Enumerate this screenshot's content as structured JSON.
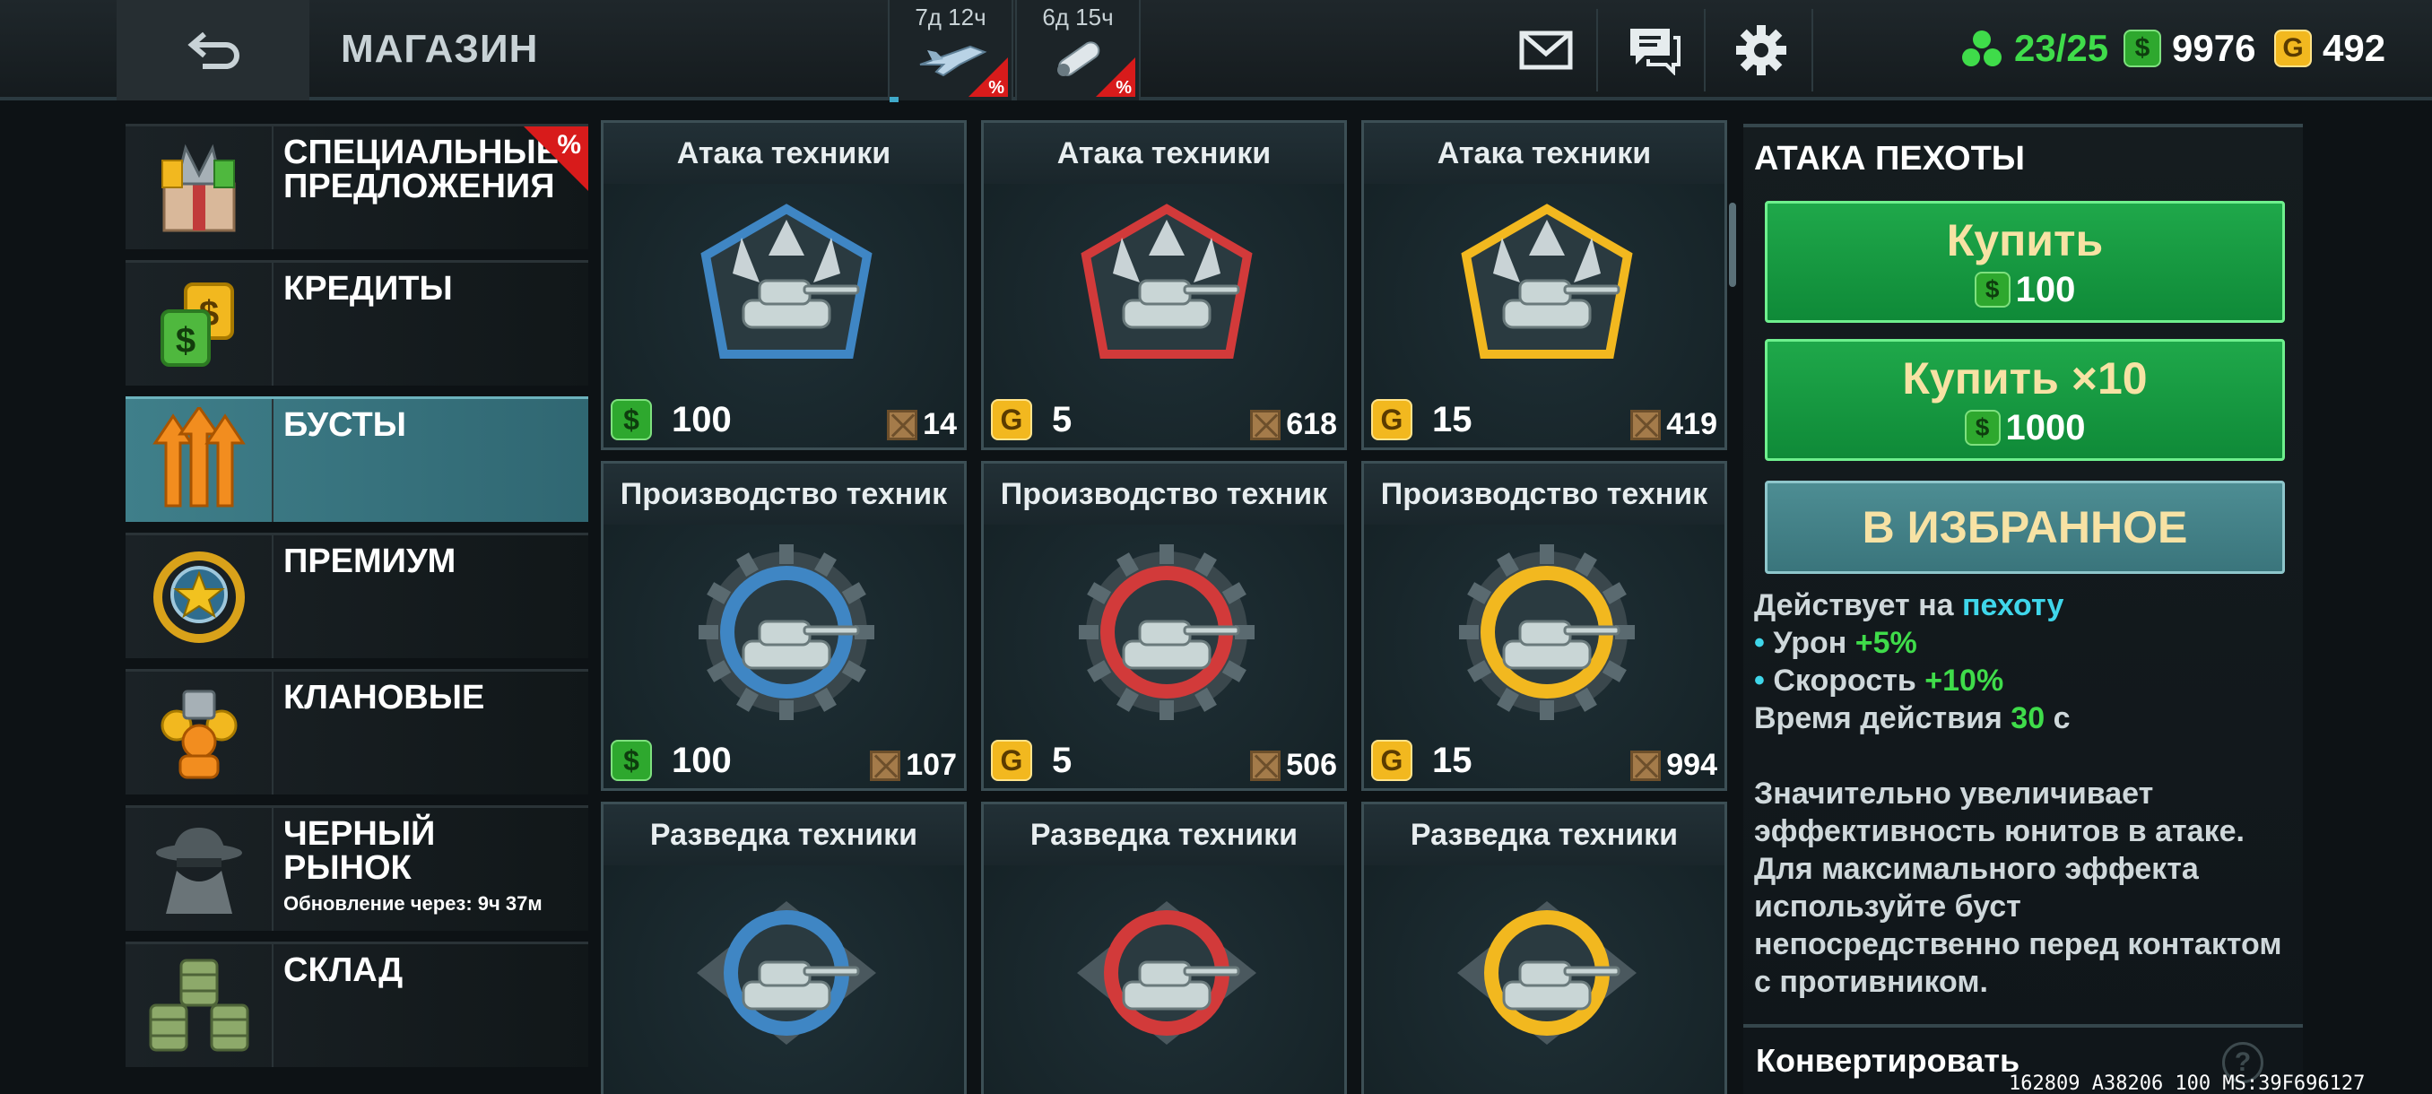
{
  "header": {
    "title": "МАГАЗИН",
    "offers": [
      {
        "timer": "7д 12ч",
        "badge": "%",
        "icon": "jet-icon"
      },
      {
        "timer": "6д 15ч",
        "badge": "%",
        "icon": "missile-icon"
      }
    ],
    "resources": {
      "energy": "23/25",
      "cash": "9976",
      "gold": "492"
    },
    "currency_glyphs": {
      "cash": "$",
      "gold": "G"
    }
  },
  "menu": [
    {
      "label": "СПЕЦИАЛЬНЫЕ ПРЕДЛОЖЕНИЯ",
      "badge": "%",
      "icon": "gift-box-icon"
    },
    {
      "label": "КРЕДИТЫ",
      "icon": "credits-icon"
    },
    {
      "label": "БУСТЫ",
      "icon": "boost-arrows-icon",
      "active": true
    },
    {
      "label": "ПРЕМИУМ",
      "icon": "premium-star-icon"
    },
    {
      "label": "КЛАНОВЫЕ",
      "icon": "clan-icon"
    },
    {
      "label": "ЧЕРНЫЙ РЫНОК",
      "sub": "Обновление через: 9ч 37м",
      "icon": "spy-icon"
    },
    {
      "label": "СКЛАД",
      "icon": "barrels-icon"
    }
  ],
  "items": [
    {
      "title": "Атака техники",
      "tier": "blue",
      "kind": "attack",
      "currency": "cash",
      "price": "100",
      "stock": "14"
    },
    {
      "title": "Атака техники",
      "tier": "red",
      "kind": "attack",
      "currency": "gold",
      "price": "5",
      "stock": "618"
    },
    {
      "title": "Атака техники",
      "tier": "gold",
      "kind": "attack",
      "currency": "gold",
      "price": "15",
      "stock": "419"
    },
    {
      "title": "Производство техник",
      "tier": "blue",
      "kind": "production",
      "currency": "cash",
      "price": "100",
      "stock": "107"
    },
    {
      "title": "Производство техник",
      "tier": "red",
      "kind": "production",
      "currency": "gold",
      "price": "5",
      "stock": "506"
    },
    {
      "title": "Производство техник",
      "tier": "gold",
      "kind": "production",
      "currency": "gold",
      "price": "15",
      "stock": "994"
    },
    {
      "title": "Разведка техники",
      "tier": "blue",
      "kind": "recon",
      "currency": "cash",
      "price": "",
      "stock": ""
    },
    {
      "title": "Разведка техники",
      "tier": "red",
      "kind": "recon",
      "currency": "gold",
      "price": "",
      "stock": ""
    },
    {
      "title": "Разведка техники",
      "tier": "gold",
      "kind": "recon",
      "currency": "gold",
      "price": "",
      "stock": ""
    }
  ],
  "tier_colors": {
    "blue": "#3f86c4",
    "red": "#d23a3a",
    "gold": "#f2b81f"
  },
  "detail": {
    "title": "АТАКА ПЕХОТЫ",
    "buy_label": "Купить",
    "buy_price": "100",
    "buy10_label": "Купить ×10",
    "buy10_price": "1000",
    "favorite_label": "В ИЗБРАННОЕ",
    "applies_prefix": "Действует на",
    "applies_target": "пехоту",
    "bullets": [
      {
        "label": "Урон",
        "value": "+5%"
      },
      {
        "label": "Скорость",
        "value": "+10%"
      }
    ],
    "duration_prefix": "Время действия",
    "duration_value": "30",
    "duration_unit": "с",
    "description": "Значительно увеличивает эффективность юнитов в атаке. Для максимального эффекта используйте буст непосредственно перед контактом с противником.",
    "convert_label": "Конвертировать",
    "help_glyph": "?"
  },
  "debug_text": "162809 A38206 100 MS:39F696127"
}
